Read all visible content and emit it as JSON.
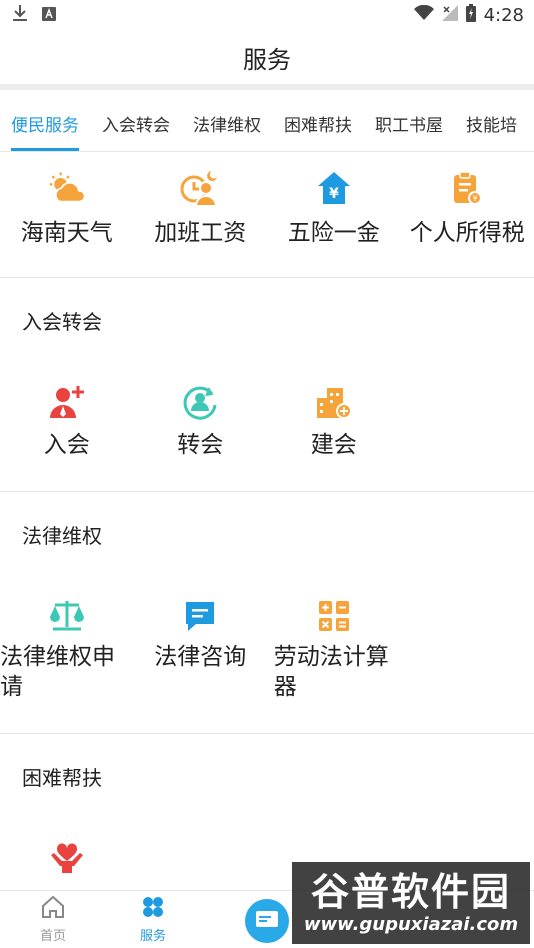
{
  "status_bar": {
    "time": "4:28"
  },
  "header": {
    "title": "服务"
  },
  "tabs": [
    {
      "label": "便民服务",
      "active": true
    },
    {
      "label": "入会转会",
      "active": false
    },
    {
      "label": "法律维权",
      "active": false
    },
    {
      "label": "困难帮扶",
      "active": false
    },
    {
      "label": "职工书屋",
      "active": false
    },
    {
      "label": "技能培",
      "active": false
    }
  ],
  "convenience": {
    "items": [
      {
        "label": "海南天气",
        "icon": "weather-icon"
      },
      {
        "label": "加班工资",
        "icon": "overtime-icon"
      },
      {
        "label": "五险一金",
        "icon": "insurance-fund-icon"
      },
      {
        "label": "个人所得税",
        "icon": "income-tax-icon"
      }
    ]
  },
  "join_section": {
    "title": "入会转会",
    "items": [
      {
        "label": "入会",
        "icon": "add-user-icon"
      },
      {
        "label": "转会",
        "icon": "transfer-icon"
      },
      {
        "label": "建会",
        "icon": "build-union-icon"
      }
    ]
  },
  "law_section": {
    "title": "法律维权",
    "items": [
      {
        "label": "法律维权申请",
        "icon": "scale-icon"
      },
      {
        "label": "法律咨询",
        "icon": "chat-icon"
      },
      {
        "label": "劳动法计算器",
        "icon": "calculator-icon"
      }
    ]
  },
  "help_section": {
    "title": "困难帮扶",
    "items": [
      {
        "label": "",
        "icon": "heart-hands-icon"
      }
    ]
  },
  "bottom_nav": {
    "home_label": "首页",
    "service_label": "服务"
  },
  "watermark": {
    "main": "谷普软件园",
    "url": "www.gupuxiazai.com"
  },
  "colors": {
    "accent": "#1e9be0",
    "orange": "#f5a33a",
    "red": "#e8433f",
    "teal": "#3cc8b4"
  }
}
